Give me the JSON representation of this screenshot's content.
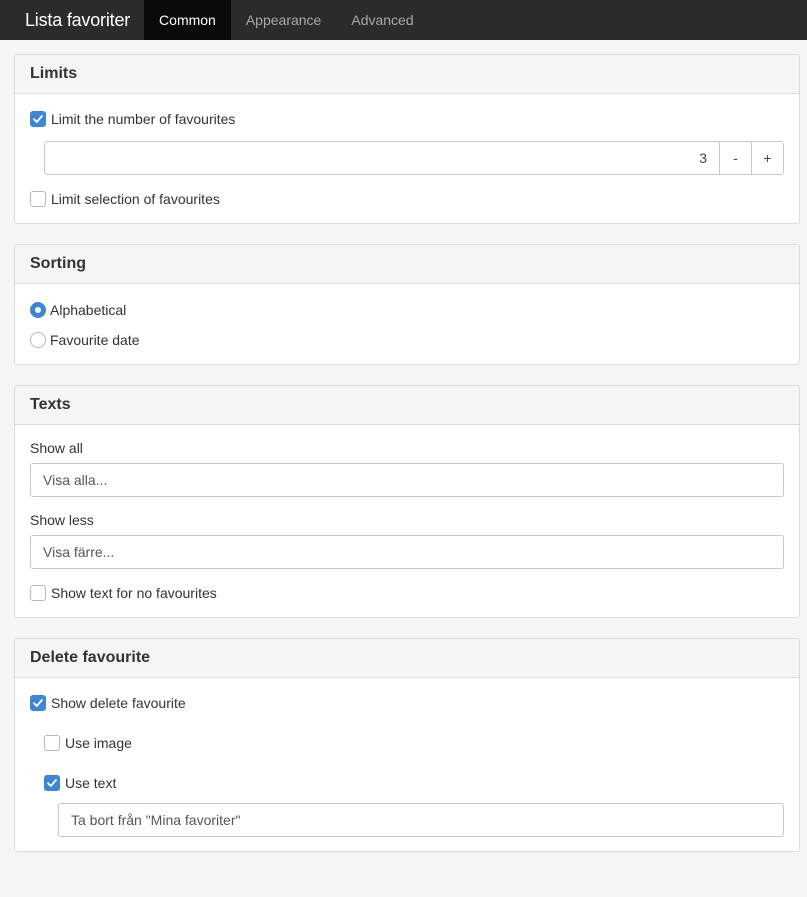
{
  "app": {
    "title": "Lista favoriter"
  },
  "tabs": [
    {
      "label": "Common",
      "active": true
    },
    {
      "label": "Appearance",
      "active": false
    },
    {
      "label": "Advanced",
      "active": false
    }
  ],
  "limits": {
    "heading": "Limits",
    "limit_number": {
      "label": "Limit the number of favourites",
      "checked": true
    },
    "stepper": {
      "value": "3",
      "minus": "-",
      "plus": "+"
    },
    "limit_selection": {
      "label": "Limit selection of favourites",
      "checked": false
    }
  },
  "sorting": {
    "heading": "Sorting",
    "options": [
      {
        "label": "Alphabetical",
        "selected": true
      },
      {
        "label": "Favourite date",
        "selected": false
      }
    ]
  },
  "texts": {
    "heading": "Texts",
    "show_all": {
      "label": "Show all",
      "value": "Visa alla..."
    },
    "show_less": {
      "label": "Show less",
      "value": "Visa färre..."
    },
    "no_favourites": {
      "label": "Show text for no favourites",
      "checked": false
    }
  },
  "delete": {
    "heading": "Delete favourite",
    "show_delete": {
      "label": "Show delete favourite",
      "checked": true
    },
    "use_image": {
      "label": "Use image",
      "checked": false
    },
    "use_text": {
      "label": "Use text",
      "checked": true
    },
    "text_value": "Ta bort från \"Mina favoriter\""
  },
  "colors": {
    "accent": "#3f86d0",
    "navbar": "#2b2b2b",
    "active_tab": "#0a0a0a"
  }
}
